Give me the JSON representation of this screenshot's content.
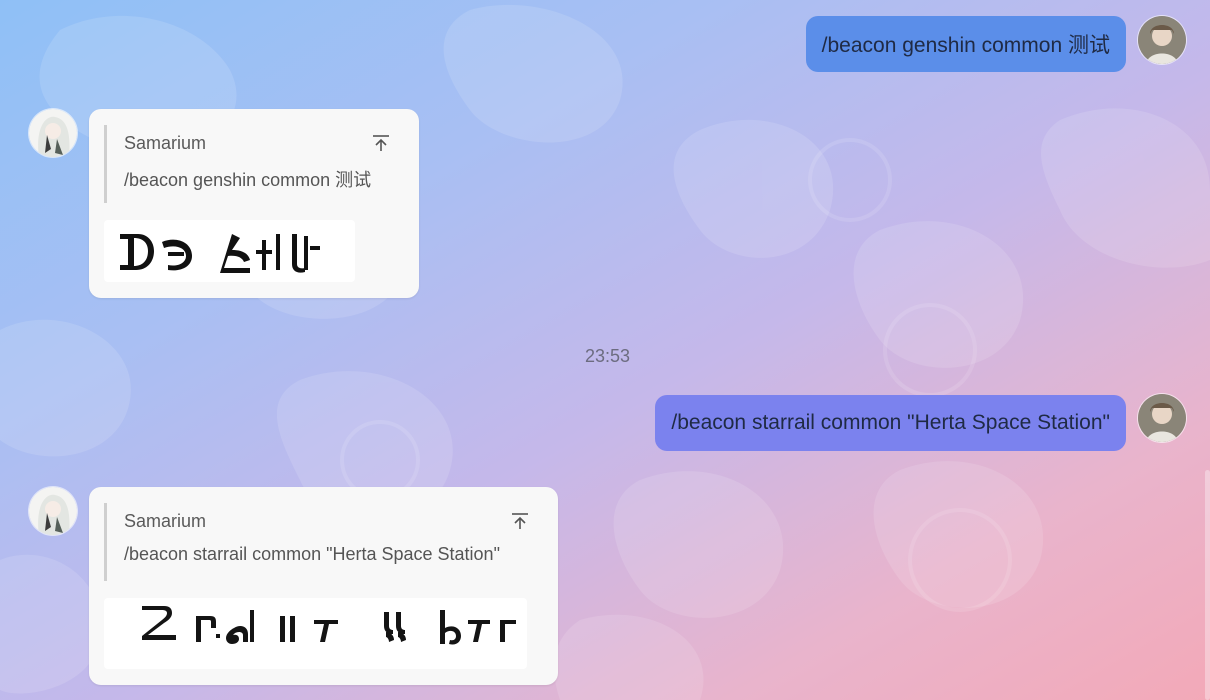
{
  "messages": [
    {
      "sender": "self",
      "text": "/beacon genshin common 测试"
    },
    {
      "sender": "bot",
      "author": "Samarium",
      "quoted_text": "/beacon genshin common 测试",
      "image_alt": "genshin common script image"
    },
    {
      "sender": "self",
      "text": "/beacon starrail common \"Herta Space Station\""
    },
    {
      "sender": "bot",
      "author": "Samarium",
      "quoted_text": "/beacon starrail common \"Herta Space Station\"",
      "image_alt": "starrail common script image"
    }
  ],
  "time_separator": "23:53",
  "colors": {
    "self_bubble_1": "#5b8ee9",
    "self_bubble_2": "#7b82ee",
    "card_bg": "#f8f8f8",
    "quote_bar": "#cfcfcf"
  },
  "icons": {
    "jump": "arrow-up-to-top-icon"
  }
}
